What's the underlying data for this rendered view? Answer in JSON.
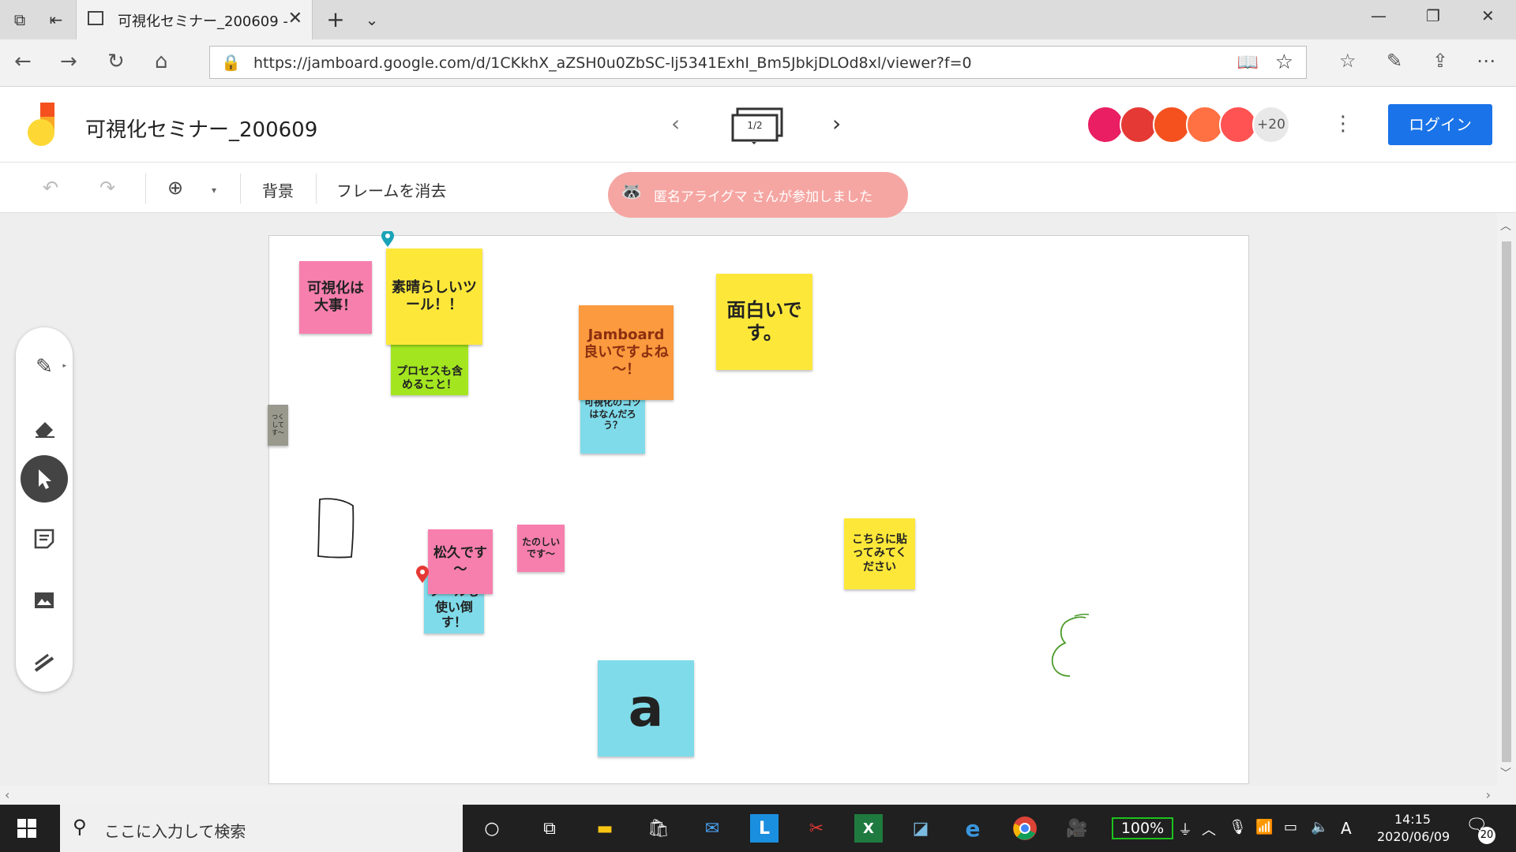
{
  "browser": {
    "tab_title": "可視化セミナー_200609 -",
    "url": "https://jamboard.google.com/d/1CKkhX_aZSH0u0ZbSC-lj5341ExhI_Bm5JbkjDLOd8xl/viewer?f=0"
  },
  "app": {
    "title": "可視化セミナー_200609",
    "frame_indicator": "1/2",
    "more_users": "+20",
    "login_label": "ログイン"
  },
  "toolbar": {
    "background_label": "背景",
    "clear_frame_label": "フレームを消去"
  },
  "toast": {
    "text": "匿名アライグマ さんが参加しました"
  },
  "notes": {
    "n1": "可視化は大事！",
    "n2": "素晴らしいツール！！",
    "n3": "プロセスも含めること！",
    "n4": "Jamboard良いですよね～！",
    "n5": "可視化のコツはなんだろう？",
    "n6": "面白いです。",
    "n7": "つくしてす～",
    "n8": "松久です～",
    "n9": "たのしいです～",
    "n10": "ツールも使い倒す！",
    "n11": "こちらに貼ってみてください",
    "n12": "a"
  },
  "taskbar": {
    "search_placeholder": "ここに入力して検索",
    "battery": "100%",
    "ime": "A",
    "time": "14:15",
    "date": "2020/06/09",
    "notifications": "20"
  },
  "colors": {
    "pink": "#f77fad",
    "yellow": "#fde83a",
    "green": "#a3e620",
    "orange": "#fb9a3e",
    "blue": "#7fdbea",
    "gray": "#999a8d",
    "accent": "#1a73e8"
  },
  "icons": {
    "tools": [
      "pen-icon",
      "eraser-icon",
      "select-icon",
      "sticky-note-icon",
      "image-icon",
      "laser-icon"
    ]
  }
}
